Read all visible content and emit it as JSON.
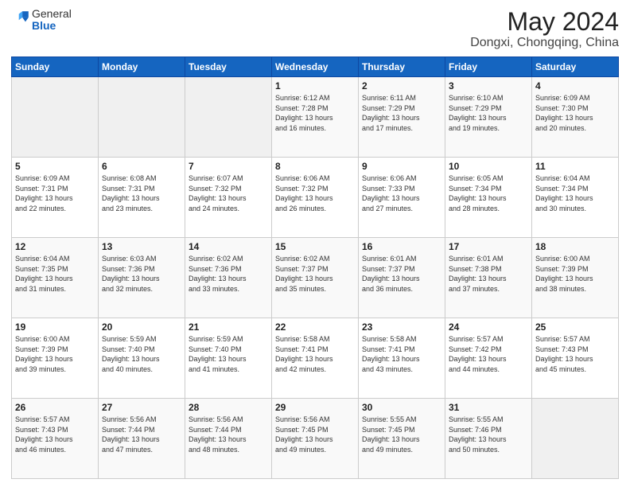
{
  "header": {
    "logo_general": "General",
    "logo_blue": "Blue",
    "title": "May 2024",
    "subtitle": "Dongxi, Chongqing, China"
  },
  "days_of_week": [
    "Sunday",
    "Monday",
    "Tuesday",
    "Wednesday",
    "Thursday",
    "Friday",
    "Saturday"
  ],
  "weeks": [
    [
      {
        "day": "",
        "info": ""
      },
      {
        "day": "",
        "info": ""
      },
      {
        "day": "",
        "info": ""
      },
      {
        "day": "1",
        "info": "Sunrise: 6:12 AM\nSunset: 7:28 PM\nDaylight: 13 hours\nand 16 minutes."
      },
      {
        "day": "2",
        "info": "Sunrise: 6:11 AM\nSunset: 7:29 PM\nDaylight: 13 hours\nand 17 minutes."
      },
      {
        "day": "3",
        "info": "Sunrise: 6:10 AM\nSunset: 7:29 PM\nDaylight: 13 hours\nand 19 minutes."
      },
      {
        "day": "4",
        "info": "Sunrise: 6:09 AM\nSunset: 7:30 PM\nDaylight: 13 hours\nand 20 minutes."
      }
    ],
    [
      {
        "day": "5",
        "info": "Sunrise: 6:09 AM\nSunset: 7:31 PM\nDaylight: 13 hours\nand 22 minutes."
      },
      {
        "day": "6",
        "info": "Sunrise: 6:08 AM\nSunset: 7:31 PM\nDaylight: 13 hours\nand 23 minutes."
      },
      {
        "day": "7",
        "info": "Sunrise: 6:07 AM\nSunset: 7:32 PM\nDaylight: 13 hours\nand 24 minutes."
      },
      {
        "day": "8",
        "info": "Sunrise: 6:06 AM\nSunset: 7:32 PM\nDaylight: 13 hours\nand 26 minutes."
      },
      {
        "day": "9",
        "info": "Sunrise: 6:06 AM\nSunset: 7:33 PM\nDaylight: 13 hours\nand 27 minutes."
      },
      {
        "day": "10",
        "info": "Sunrise: 6:05 AM\nSunset: 7:34 PM\nDaylight: 13 hours\nand 28 minutes."
      },
      {
        "day": "11",
        "info": "Sunrise: 6:04 AM\nSunset: 7:34 PM\nDaylight: 13 hours\nand 30 minutes."
      }
    ],
    [
      {
        "day": "12",
        "info": "Sunrise: 6:04 AM\nSunset: 7:35 PM\nDaylight: 13 hours\nand 31 minutes."
      },
      {
        "day": "13",
        "info": "Sunrise: 6:03 AM\nSunset: 7:36 PM\nDaylight: 13 hours\nand 32 minutes."
      },
      {
        "day": "14",
        "info": "Sunrise: 6:02 AM\nSunset: 7:36 PM\nDaylight: 13 hours\nand 33 minutes."
      },
      {
        "day": "15",
        "info": "Sunrise: 6:02 AM\nSunset: 7:37 PM\nDaylight: 13 hours\nand 35 minutes."
      },
      {
        "day": "16",
        "info": "Sunrise: 6:01 AM\nSunset: 7:37 PM\nDaylight: 13 hours\nand 36 minutes."
      },
      {
        "day": "17",
        "info": "Sunrise: 6:01 AM\nSunset: 7:38 PM\nDaylight: 13 hours\nand 37 minutes."
      },
      {
        "day": "18",
        "info": "Sunrise: 6:00 AM\nSunset: 7:39 PM\nDaylight: 13 hours\nand 38 minutes."
      }
    ],
    [
      {
        "day": "19",
        "info": "Sunrise: 6:00 AM\nSunset: 7:39 PM\nDaylight: 13 hours\nand 39 minutes."
      },
      {
        "day": "20",
        "info": "Sunrise: 5:59 AM\nSunset: 7:40 PM\nDaylight: 13 hours\nand 40 minutes."
      },
      {
        "day": "21",
        "info": "Sunrise: 5:59 AM\nSunset: 7:40 PM\nDaylight: 13 hours\nand 41 minutes."
      },
      {
        "day": "22",
        "info": "Sunrise: 5:58 AM\nSunset: 7:41 PM\nDaylight: 13 hours\nand 42 minutes."
      },
      {
        "day": "23",
        "info": "Sunrise: 5:58 AM\nSunset: 7:41 PM\nDaylight: 13 hours\nand 43 minutes."
      },
      {
        "day": "24",
        "info": "Sunrise: 5:57 AM\nSunset: 7:42 PM\nDaylight: 13 hours\nand 44 minutes."
      },
      {
        "day": "25",
        "info": "Sunrise: 5:57 AM\nSunset: 7:43 PM\nDaylight: 13 hours\nand 45 minutes."
      }
    ],
    [
      {
        "day": "26",
        "info": "Sunrise: 5:57 AM\nSunset: 7:43 PM\nDaylight: 13 hours\nand 46 minutes."
      },
      {
        "day": "27",
        "info": "Sunrise: 5:56 AM\nSunset: 7:44 PM\nDaylight: 13 hours\nand 47 minutes."
      },
      {
        "day": "28",
        "info": "Sunrise: 5:56 AM\nSunset: 7:44 PM\nDaylight: 13 hours\nand 48 minutes."
      },
      {
        "day": "29",
        "info": "Sunrise: 5:56 AM\nSunset: 7:45 PM\nDaylight: 13 hours\nand 49 minutes."
      },
      {
        "day": "30",
        "info": "Sunrise: 5:55 AM\nSunset: 7:45 PM\nDaylight: 13 hours\nand 49 minutes."
      },
      {
        "day": "31",
        "info": "Sunrise: 5:55 AM\nSunset: 7:46 PM\nDaylight: 13 hours\nand 50 minutes."
      },
      {
        "day": "",
        "info": ""
      }
    ]
  ]
}
